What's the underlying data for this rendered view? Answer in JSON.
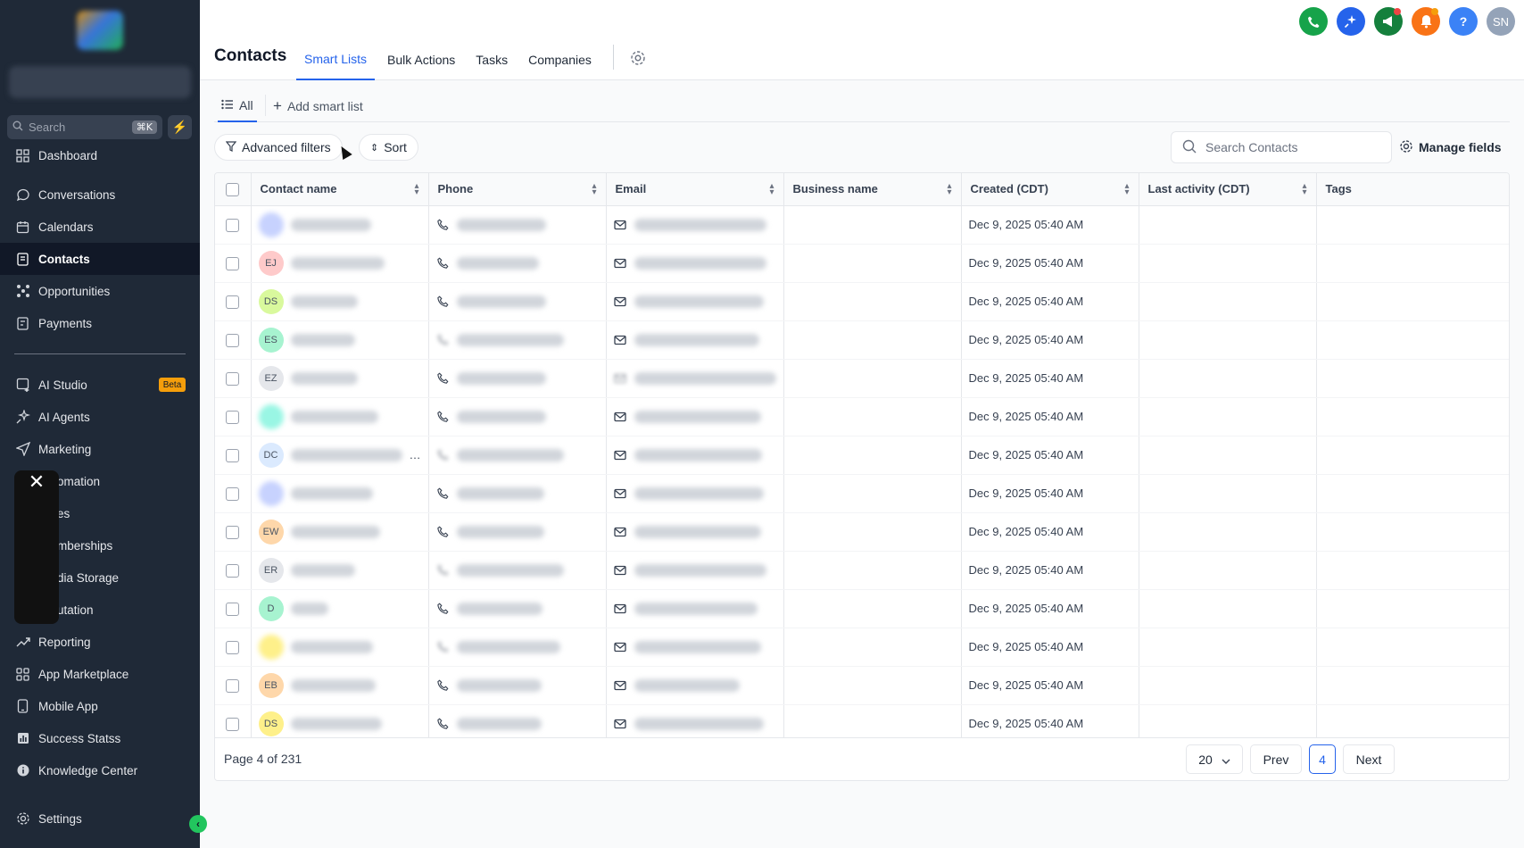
{
  "sidebar": {
    "search_placeholder": "Search",
    "search_shortcut": "⌘K",
    "nav": [
      {
        "label": "Dashboard",
        "icon": "dashboard-icon"
      },
      {
        "label": "Conversations",
        "icon": "chat-icon"
      },
      {
        "label": "Calendars",
        "icon": "calendar-icon"
      },
      {
        "label": "Contacts",
        "icon": "contacts-icon",
        "active": true
      },
      {
        "label": "Opportunities",
        "icon": "opportunities-icon"
      },
      {
        "label": "Payments",
        "icon": "payments-icon"
      },
      {
        "label": "AI Studio",
        "icon": "ai-studio-icon",
        "badge": "Beta"
      },
      {
        "label": "AI Agents",
        "icon": "sparkle-icon"
      },
      {
        "label": "Marketing",
        "icon": "send-icon"
      },
      {
        "label": "omation",
        "icon": "automation-icon"
      },
      {
        "label": "es",
        "icon": "sites-icon"
      },
      {
        "label": "mberships",
        "icon": "memberships-icon"
      },
      {
        "label": "dia Storage",
        "icon": "media-icon"
      },
      {
        "label": "utation",
        "icon": "reputation-icon"
      },
      {
        "label": "Reporting",
        "icon": "trend-icon"
      },
      {
        "label": "App Marketplace",
        "icon": "grid-icon"
      },
      {
        "label": "Mobile App",
        "icon": "mobile-icon"
      },
      {
        "label": "Success Statss",
        "icon": "stats-icon"
      },
      {
        "label": "Knowledge Center",
        "icon": "info-icon"
      }
    ],
    "settings_label": "Settings"
  },
  "header": {
    "title": "Contacts",
    "tabs": [
      "Smart Lists",
      "Bulk Actions",
      "Tasks",
      "Companies"
    ],
    "active_tab": "Smart Lists",
    "user_initials": "SN",
    "icon_colors": {
      "phone": "#16a34a",
      "sparkle": "#2563eb",
      "announce": "#15803d",
      "bell": "#f97316",
      "help": "#3b82f6",
      "avatar": "#94a3b8"
    }
  },
  "smart_lists": {
    "all_label": "All",
    "add_label": "Add smart list"
  },
  "toolbar": {
    "advanced_filters": "Advanced filters",
    "sort": "Sort",
    "search_placeholder": "Search Contacts",
    "manage_fields": "Manage fields"
  },
  "table": {
    "columns": [
      "Contact name",
      "Phone",
      "Email",
      "Business name",
      "Created (CDT)",
      "Last activity (CDT)",
      "Tags"
    ],
    "rows": [
      {
        "initials": "",
        "avatar_color": "#c7d2fe",
        "created": "Dec 9, 2025 05:40 AM",
        "phone_blur": false,
        "email_blur": false
      },
      {
        "initials": "EJ",
        "avatar_color": "#fecaca",
        "created": "Dec 9, 2025 05:40 AM",
        "phone_blur": false,
        "email_blur": false
      },
      {
        "initials": "DS",
        "avatar_color": "#d9f99d",
        "created": "Dec 9, 2025 05:40 AM",
        "phone_blur": false,
        "email_blur": false
      },
      {
        "initials": "ES",
        "avatar_color": "#a7f3d0",
        "created": "Dec 9, 2025 05:40 AM",
        "phone_blur": true,
        "email_blur": false
      },
      {
        "initials": "EZ",
        "avatar_color": "#e5e7eb",
        "created": "Dec 9, 2025 05:40 AM",
        "phone_blur": false,
        "email_blur": true
      },
      {
        "initials": "",
        "avatar_color": "#99f6e4",
        "created": "Dec 9, 2025 05:40 AM",
        "phone_blur": false,
        "email_blur": false
      },
      {
        "initials": "DC",
        "avatar_color": "#dbeafe",
        "created": "Dec 9, 2025 05:40 AM",
        "phone_blur": true,
        "email_blur": false,
        "ellipsis": "…"
      },
      {
        "initials": "",
        "avatar_color": "#c7d2fe",
        "created": "Dec 9, 2025 05:40 AM",
        "phone_blur": false,
        "email_blur": false
      },
      {
        "initials": "EW",
        "avatar_color": "#fed7aa",
        "created": "Dec 9, 2025 05:40 AM",
        "phone_blur": false,
        "email_blur": false
      },
      {
        "initials": "ER",
        "avatar_color": "#e5e7eb",
        "created": "Dec 9, 2025 05:40 AM",
        "phone_blur": true,
        "email_blur": false
      },
      {
        "initials": "D",
        "avatar_color": "#a7f3d0",
        "created": "Dec 9, 2025 05:40 AM",
        "phone_blur": false,
        "email_blur": false
      },
      {
        "initials": "",
        "avatar_color": "#fef08a",
        "created": "Dec 9, 2025 05:40 AM",
        "phone_blur": true,
        "email_blur": false
      },
      {
        "initials": "EB",
        "avatar_color": "#fed7aa",
        "created": "Dec 9, 2025 05:40 AM",
        "phone_blur": false,
        "email_blur": false
      },
      {
        "initials": "DS",
        "avatar_color": "#fef08a",
        "created": "Dec 9, 2025 05:40 AM",
        "phone_blur": false,
        "email_blur": false
      }
    ]
  },
  "pagination": {
    "info": "Page 4 of 231",
    "page_size": "20",
    "prev": "Prev",
    "current": "4",
    "next": "Next"
  }
}
